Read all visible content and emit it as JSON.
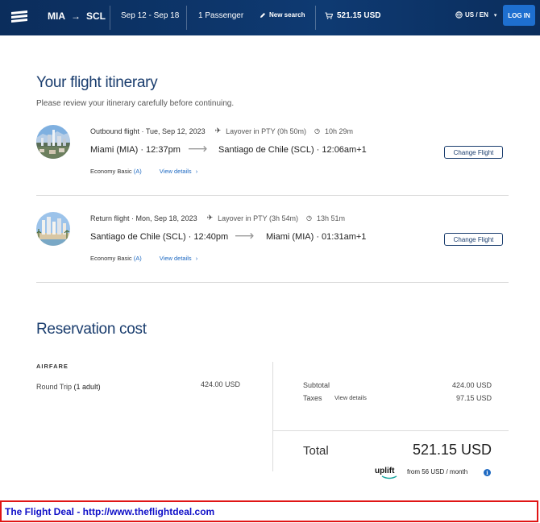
{
  "header": {
    "origin": "MIA",
    "destination": "SCL",
    "dates": "Sep 12 - Sep 18",
    "passengers": "1 Passenger",
    "new_search": "New search",
    "cart_total": "521.15 USD",
    "locale": "US / EN",
    "login": "LOG IN",
    "colors": {
      "bar": "#0e3a72",
      "login": "#1e6fd0"
    }
  },
  "itinerary": {
    "title": "Your flight itinerary",
    "subtitle": "Please review your itinerary carefully before continuing.",
    "flights": [
      {
        "label": "Outbound flight · Tue, Sep 12, 2023",
        "layover": "Layover in PTY (0h 50m)",
        "duration": "10h 29m",
        "from": "Miami (MIA) · 12:37pm",
        "to": "Santiago de Chile (SCL) · 12:06am+1",
        "fare": "Economy Basic",
        "fare_code": "(A)",
        "details": "View details",
        "change": "Change Flight",
        "image_icon": "santiago-city-photo"
      },
      {
        "label": "Return flight · Mon, Sep 18, 2023",
        "layover": "Layover in PTY (3h 54m)",
        "duration": "13h 51m",
        "from": "Santiago de Chile (SCL) · 12:40pm",
        "to": "Miami (MIA) · 01:31am+1",
        "fare": "Economy Basic",
        "fare_code": "(A)",
        "details": "View details",
        "change": "Change Flight",
        "image_icon": "miami-city-photo"
      }
    ]
  },
  "cost": {
    "title": "Reservation cost",
    "airfare_label": "AIRFARE",
    "round_trip": "Round Trip",
    "adults": "(1 adult)",
    "round_trip_amount": "424.00 USD",
    "subtotal_label": "Subtotal",
    "subtotal": "424.00 USD",
    "taxes_label": "Taxes",
    "taxes_link": "View details",
    "taxes": "97.15 USD",
    "total_label": "Total",
    "total": "521.15 USD",
    "uplift_brand": "uplift",
    "uplift_text": "from 56 USD  / month"
  },
  "banner": {
    "text": "The Flight Deal - http://www.theflightdeal.com"
  }
}
